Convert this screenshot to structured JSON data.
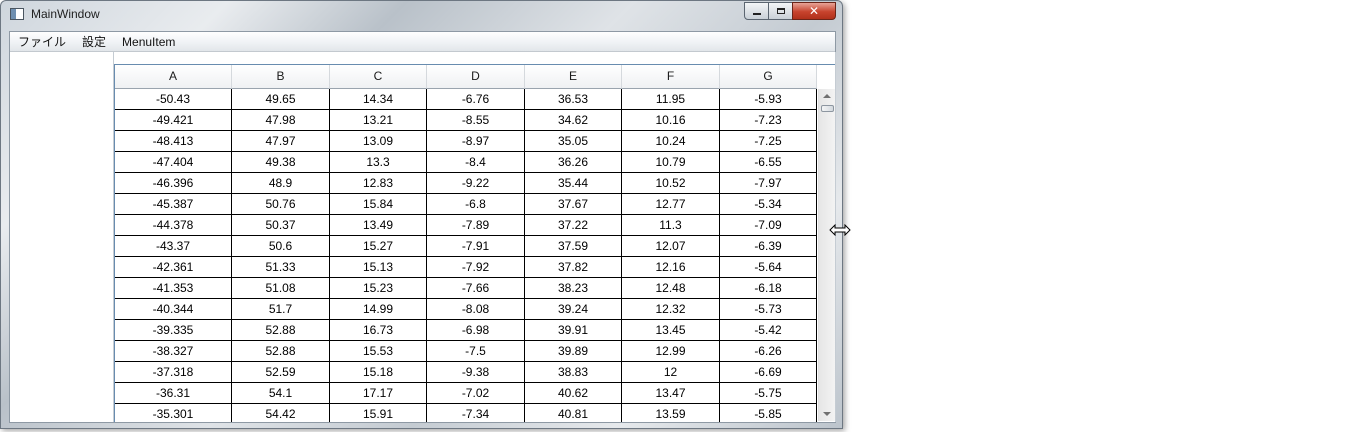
{
  "window": {
    "title": "MainWindow"
  },
  "menu": [
    "ファイル",
    "設定",
    "MenuItem"
  ],
  "grid": {
    "columns": [
      "A",
      "B",
      "C",
      "D",
      "E",
      "F",
      "G"
    ],
    "rows": [
      [
        "-50.43",
        "49.65",
        "14.34",
        "-6.76",
        "36.53",
        "11.95",
        "-5.93"
      ],
      [
        "-49.421",
        "47.98",
        "13.21",
        "-8.55",
        "34.62",
        "10.16",
        "-7.23"
      ],
      [
        "-48.413",
        "47.97",
        "13.09",
        "-8.97",
        "35.05",
        "10.24",
        "-7.25"
      ],
      [
        "-47.404",
        "49.38",
        "13.3",
        "-8.4",
        "36.26",
        "10.79",
        "-6.55"
      ],
      [
        "-46.396",
        "48.9",
        "12.83",
        "-9.22",
        "35.44",
        "10.52",
        "-7.97"
      ],
      [
        "-45.387",
        "50.76",
        "15.84",
        "-6.8",
        "37.67",
        "12.77",
        "-5.34"
      ],
      [
        "-44.378",
        "50.37",
        "13.49",
        "-7.89",
        "37.22",
        "11.3",
        "-7.09"
      ],
      [
        "-43.37",
        "50.6",
        "15.27",
        "-7.91",
        "37.59",
        "12.07",
        "-6.39"
      ],
      [
        "-42.361",
        "51.33",
        "15.13",
        "-7.92",
        "37.82",
        "12.16",
        "-5.64"
      ],
      [
        "-41.353",
        "51.08",
        "15.23",
        "-7.66",
        "38.23",
        "12.48",
        "-6.18"
      ],
      [
        "-40.344",
        "51.7",
        "14.99",
        "-8.08",
        "39.24",
        "12.32",
        "-5.73"
      ],
      [
        "-39.335",
        "52.88",
        "16.73",
        "-6.98",
        "39.91",
        "13.45",
        "-5.42"
      ],
      [
        "-38.327",
        "52.88",
        "15.53",
        "-7.5",
        "39.89",
        "12.99",
        "-6.26"
      ],
      [
        "-37.318",
        "52.59",
        "15.18",
        "-9.38",
        "38.83",
        "12",
        "-6.69"
      ],
      [
        "-36.31",
        "54.1",
        "17.17",
        "-7.02",
        "40.62",
        "13.47",
        "-5.75"
      ],
      [
        "-35.301",
        "54.42",
        "15.91",
        "-7.34",
        "40.81",
        "13.59",
        "-5.85"
      ]
    ]
  },
  "icons": {
    "app": "window-app-icon",
    "minimize": "minimize-icon",
    "maximize": "maximize-icon",
    "close": "close-icon",
    "cursor": "horizontal-resize-cursor-icon"
  },
  "colors": {
    "close_button": "#c7432d",
    "grid_border": "#688caf"
  }
}
